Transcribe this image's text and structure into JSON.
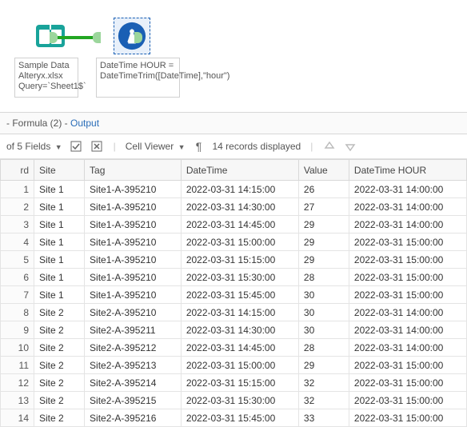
{
  "canvas": {
    "input_tool": {
      "label": "Sample Data Alteryx.xlsx Query=`Sheet1$`"
    },
    "formula_tool": {
      "label": "DateTime HOUR = DateTimeTrim([DateTime],\"hour\")"
    }
  },
  "results": {
    "breadcrumb_part": "- Formula (2) - ",
    "breadcrumb_link": "Output"
  },
  "toolbar": {
    "fields_label": "of 5 Fields",
    "cell_viewer_label": "Cell Viewer",
    "records_label": "14 records displayed"
  },
  "columns": {
    "record": "rd",
    "site": "Site",
    "tag": "Tag",
    "datetime": "DateTime",
    "value": "Value",
    "dthour": "DateTime HOUR"
  },
  "rows": [
    {
      "n": "1",
      "site": "Site 1",
      "tag": "Site1-A-395210",
      "dt": "2022-03-31 14:15:00",
      "val": "26",
      "dth": "2022-03-31 14:00:00"
    },
    {
      "n": "2",
      "site": "Site 1",
      "tag": "Site1-A-395210",
      "dt": "2022-03-31 14:30:00",
      "val": "27",
      "dth": "2022-03-31 14:00:00"
    },
    {
      "n": "3",
      "site": "Site 1",
      "tag": "Site1-A-395210",
      "dt": "2022-03-31 14:45:00",
      "val": "29",
      "dth": "2022-03-31 14:00:00"
    },
    {
      "n": "4",
      "site": "Site 1",
      "tag": "Site1-A-395210",
      "dt": "2022-03-31 15:00:00",
      "val": "29",
      "dth": "2022-03-31 15:00:00"
    },
    {
      "n": "5",
      "site": "Site 1",
      "tag": "Site1-A-395210",
      "dt": "2022-03-31 15:15:00",
      "val": "29",
      "dth": "2022-03-31 15:00:00"
    },
    {
      "n": "6",
      "site": "Site 1",
      "tag": "Site1-A-395210",
      "dt": "2022-03-31 15:30:00",
      "val": "28",
      "dth": "2022-03-31 15:00:00"
    },
    {
      "n": "7",
      "site": "Site 1",
      "tag": "Site1-A-395210",
      "dt": "2022-03-31 15:45:00",
      "val": "30",
      "dth": "2022-03-31 15:00:00"
    },
    {
      "n": "8",
      "site": "Site 2",
      "tag": "Site2-A-395210",
      "dt": "2022-03-31 14:15:00",
      "val": "30",
      "dth": "2022-03-31 14:00:00"
    },
    {
      "n": "9",
      "site": "Site 2",
      "tag": "Site2-A-395211",
      "dt": "2022-03-31 14:30:00",
      "val": "30",
      "dth": "2022-03-31 14:00:00"
    },
    {
      "n": "10",
      "site": "Site 2",
      "tag": "Site2-A-395212",
      "dt": "2022-03-31 14:45:00",
      "val": "28",
      "dth": "2022-03-31 14:00:00"
    },
    {
      "n": "11",
      "site": "Site 2",
      "tag": "Site2-A-395213",
      "dt": "2022-03-31 15:00:00",
      "val": "29",
      "dth": "2022-03-31 15:00:00"
    },
    {
      "n": "12",
      "site": "Site 2",
      "tag": "Site2-A-395214",
      "dt": "2022-03-31 15:15:00",
      "val": "32",
      "dth": "2022-03-31 15:00:00"
    },
    {
      "n": "13",
      "site": "Site 2",
      "tag": "Site2-A-395215",
      "dt": "2022-03-31 15:30:00",
      "val": "32",
      "dth": "2022-03-31 15:00:00"
    },
    {
      "n": "14",
      "site": "Site 2",
      "tag": "Site2-A-395216",
      "dt": "2022-03-31 15:45:00",
      "val": "33",
      "dth": "2022-03-31 15:00:00"
    }
  ]
}
